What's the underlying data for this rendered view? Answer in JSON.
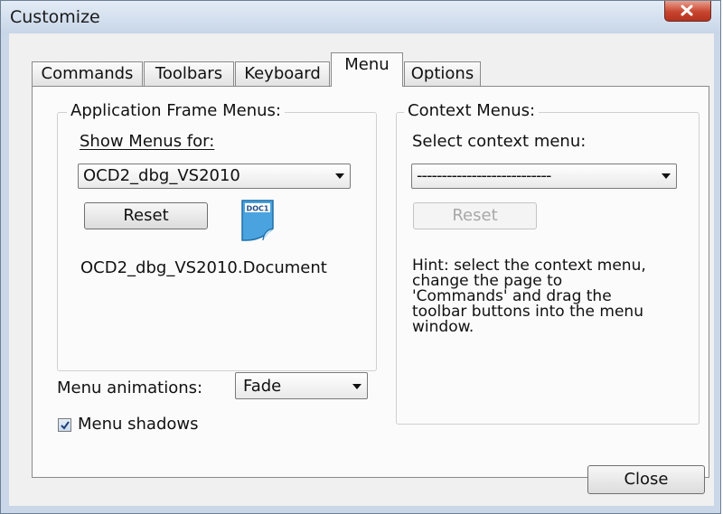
{
  "window": {
    "title": "Customize"
  },
  "tabs": [
    {
      "label": "Commands"
    },
    {
      "label": "Toolbars"
    },
    {
      "label": "Keyboard"
    },
    {
      "label": "Menu"
    },
    {
      "label": "Options"
    }
  ],
  "active_tab": "Menu",
  "app_frame": {
    "legend": "Application Frame Menus:",
    "show_menus_label": "Show Menus for:",
    "show_menus_value": "OCD2_dbg_VS2010",
    "reset_label": "Reset",
    "icon_text": "DOC1",
    "doc_name": "OCD2_dbg_VS2010.Document"
  },
  "context": {
    "legend": "Context Menus:",
    "select_label": "Select context menu:",
    "select_value": "---------------------------",
    "reset_label": "Reset",
    "hint": "Hint: select the context menu,\nchange the page to\n'Commands' and drag the\ntoolbar buttons into the menu\nwindow."
  },
  "menu_animations": {
    "label": "Menu animations:",
    "value": "Fade"
  },
  "menu_shadows": {
    "label": "Menu shadows",
    "checked": true
  },
  "footer": {
    "close_label": "Close"
  },
  "colors": {
    "title_bar": "#c9d7e8",
    "close_button": "#c8452f",
    "doc_icon": "#4aa3df"
  }
}
